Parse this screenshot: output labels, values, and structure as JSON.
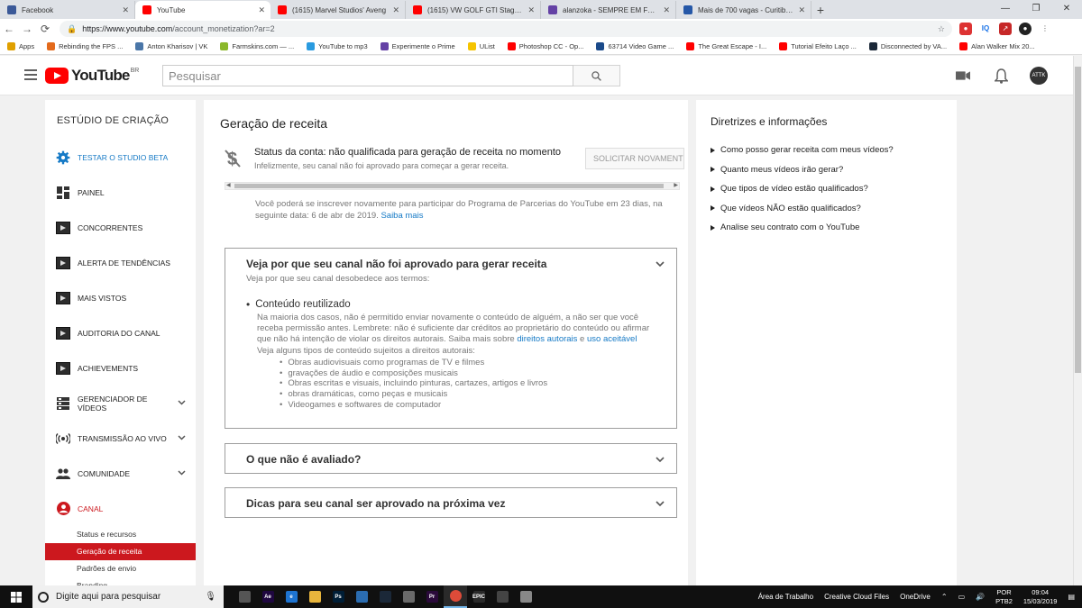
{
  "browser": {
    "tabs": [
      {
        "title": "Facebook",
        "color": "#3b5998",
        "close": "✕"
      },
      {
        "title": "YouTube",
        "color": "#ff0000",
        "close": "✕"
      },
      {
        "title": "(1615) Marvel Studios' Aveng",
        "color": "#ff0000",
        "close": "✕"
      },
      {
        "title": "(1615) VW GOLF GTI Stage 3 440c",
        "color": "#ff0000",
        "close": "✕"
      },
      {
        "title": "alanzoka - SEMPRE EM FRENTE -",
        "color": "#6441a5",
        "close": "✕"
      },
      {
        "title": "Mais de 700 vagas - Curitiba, PR",
        "color": "#2557a7",
        "close": "✕"
      }
    ],
    "new_tab": "+",
    "url_host": "https://www.youtube.com",
    "url_path": "/account_monetization?ar=2",
    "window_controls": [
      "—",
      "❐",
      "✕"
    ]
  },
  "bookmarks": [
    {
      "label": "Apps",
      "color": "#e0a000"
    },
    {
      "label": "Rebinding the FPS ...",
      "color": "#e36a1c"
    },
    {
      "label": "Anton Kharisov | VK",
      "color": "#4a76a8"
    },
    {
      "label": "Farmskins.com — ...",
      "color": "#8bb82b"
    },
    {
      "label": "YouTube to mp3",
      "color": "#2a9be0"
    },
    {
      "label": "Experimente o Prime",
      "color": "#6441a5"
    },
    {
      "label": "UList",
      "color": "#f5c400"
    },
    {
      "label": "Photoshop CC - Op...",
      "color": "#ff0000"
    },
    {
      "label": "63714 Video Game ...",
      "color": "#1a4a8a"
    },
    {
      "label": "The Great Escape - I...",
      "color": "#ff0000"
    },
    {
      "label": "Tutorial Efeito Laço ...",
      "color": "#ff0000"
    },
    {
      "label": "Disconnected by VA...",
      "color": "#1b2838"
    },
    {
      "label": "Alan Walker Mix 20...",
      "color": "#ff0000"
    }
  ],
  "youtube": {
    "logo_text": "YouTube",
    "country_code": "BR",
    "search_placeholder": "Pesquisar",
    "avatar_text": "ATTK"
  },
  "sidebar": {
    "title": "ESTÚDIO DE CRIAÇÃO",
    "items": [
      {
        "label": "TESTAR O STUDIO BETA",
        "icon": "gear-icon",
        "style": "blue"
      },
      {
        "label": "PAINEL",
        "icon": "dashboard-icon",
        "style": ""
      },
      {
        "label": "CONCORRENTES",
        "icon": "extension-icon",
        "style": ""
      },
      {
        "label": "ALERTA DE TENDÊNCIAS",
        "icon": "extension-icon",
        "style": ""
      },
      {
        "label": "MAIS VISTOS",
        "icon": "extension-icon",
        "style": ""
      },
      {
        "label": "AUDITORIA DO CANAL",
        "icon": "extension-icon",
        "style": ""
      },
      {
        "label": "ACHIEVEMENTS",
        "icon": "extension-icon",
        "style": ""
      },
      {
        "label": "GERENCIADOR DE VÍDEOS",
        "icon": "video-manager-icon",
        "style": "",
        "expand": "⌄"
      },
      {
        "label": "TRANSMISSÃO AO VIVO",
        "icon": "live-icon",
        "style": "",
        "expand": "⌄"
      },
      {
        "label": "COMUNIDADE",
        "icon": "community-icon",
        "style": "",
        "expand": "⌄"
      },
      {
        "label": "CANAL",
        "icon": "channel-icon",
        "style": "red"
      }
    ],
    "subitems": [
      "Status e recursos",
      "Geração de receita",
      "Padrões de envio",
      "Branding"
    ],
    "active_subitem": "Geração de receita"
  },
  "main": {
    "title": "Geração de receita",
    "status_title": "Status da conta: não qualificada para geração de receita no momento",
    "status_sub": "Infelizmente, seu canal não foi aprovado para começar a gerar receita.",
    "reapply_button": "SOLICITAR NOVAMENTE",
    "reapply_note": "Você poderá se inscrever novamente para participar do Programa de Parcerias do YouTube em 23 dias, na seguinte data: 6 de abr de 2019.",
    "reapply_link": "Saiba mais",
    "accordion1": {
      "title": "Veja por que seu canal não foi aprovado para gerar receita",
      "intro": "Veja por que seu canal desobedece aos termos:",
      "reason_title": "Conteúdo reutilizado",
      "reason_text": "Na maioria dos casos, não é permitido enviar novamente o conteúdo de alguém, a não ser que você receba permissão antes. Lembrete: não é suficiente dar créditos ao proprietário do conteúdo ou afirmar que não há intenção de violar os direitos autorais. Saiba mais sobre",
      "link_copyright": "direitos autorais",
      "and": "e",
      "link_fairuse": "uso aceitável",
      "types_intro": "Veja alguns tipos de conteúdo sujeitos a direitos autorais:",
      "types": [
        "Obras audiovisuais como programas de TV e filmes",
        "gravações de áudio e composições musicais",
        "Obras escritas e visuais, incluindo pinturas, cartazes, artigos e livros",
        "obras dramáticas, como peças e musicais",
        "Videogames e softwares de computador"
      ]
    },
    "accordion2": {
      "title": "O que não é avaliado?"
    },
    "accordion3": {
      "title": "Dicas para seu canal ser aprovado na próxima vez"
    }
  },
  "guide": {
    "title": "Diretrizes e informações",
    "links": [
      "Como posso gerar receita com meus vídeos?",
      "Quanto meus vídeos irão gerar?",
      "Que tipos de vídeo estão qualificados?",
      "Que vídeos NÃO estão qualificados?",
      "Analise seu contrato com o YouTube"
    ]
  },
  "taskbar": {
    "search_placeholder": "Digite aqui para pesquisar",
    "apps": [
      {
        "name": "store",
        "label": "",
        "color": "#555"
      },
      {
        "name": "after-effects",
        "label": "Ae",
        "color": "#1f0740"
      },
      {
        "name": "edge",
        "label": "e",
        "color": "#1e74d1"
      },
      {
        "name": "file-explorer",
        "label": "",
        "color": "#e8b53c"
      },
      {
        "name": "photoshop",
        "label": "Ps",
        "color": "#001e36"
      },
      {
        "name": "mail-app",
        "label": "",
        "color": "#2b6cb0"
      },
      {
        "name": "steam",
        "label": "",
        "color": "#1b2838"
      },
      {
        "name": "media-app",
        "label": "",
        "color": "#6a6a6a"
      },
      {
        "name": "premiere",
        "label": "Pr",
        "color": "#2a0a3a"
      },
      {
        "name": "chrome",
        "label": "",
        "color": "#dd4b39"
      },
      {
        "name": "epic-games",
        "label": "EPIC",
        "color": "#2a2a2a"
      },
      {
        "name": "screenshot-tool",
        "label": "",
        "color": "#444"
      },
      {
        "name": "outlook-app",
        "label": "",
        "color": "#888"
      }
    ],
    "desktop_label": "Área de Trabalho",
    "cloud_label": "Creative Cloud Files",
    "onedrive_label": "OneDrive",
    "lang": "POR",
    "layout": "PTB2",
    "time": "09:04",
    "date": "15/03/2019"
  }
}
